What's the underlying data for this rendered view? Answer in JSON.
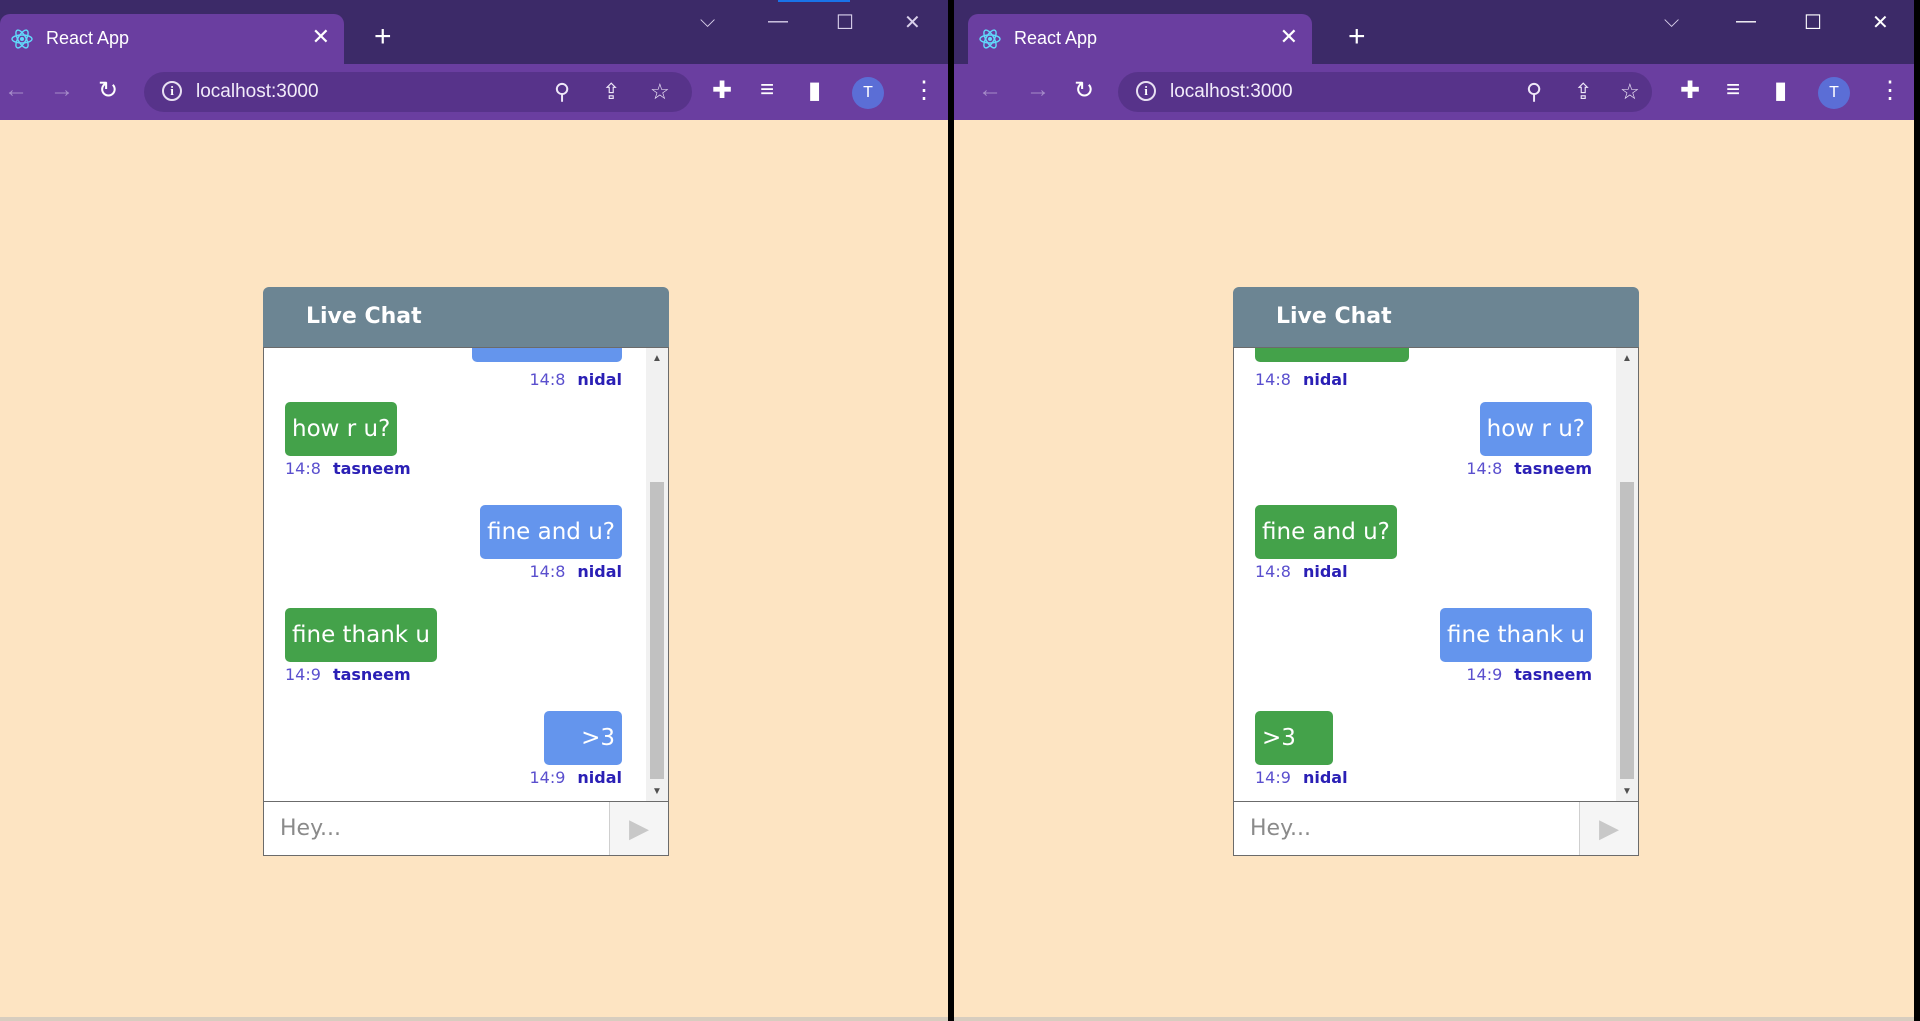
{
  "browser": {
    "tab_title": "React App",
    "tab_close": "✕",
    "new_tab": "+",
    "url": "localhost:3000",
    "avatar_initial": "T",
    "icons": [
      "react-favicon",
      "back-arrow",
      "forward-arrow",
      "reload",
      "info",
      "zoom",
      "share",
      "star",
      "extensions",
      "media-control",
      "side-panel",
      "menu"
    ]
  },
  "window_controls": {
    "dropdown": "⌵",
    "minimize": "—",
    "maximize": "☐",
    "close": "✕"
  },
  "chat": {
    "title": "Live Chat",
    "placeholder": "Hey...",
    "send_icon": "▶"
  },
  "left_messages": [
    {
      "text": "",
      "time": "14:8",
      "author": "nidal",
      "side": "right",
      "color": "blue"
    },
    {
      "text": "how r u?",
      "time": "14:8",
      "author": "tasneem",
      "side": "left",
      "color": "green"
    },
    {
      "text": "fine and u?",
      "time": "14:8",
      "author": "nidal",
      "side": "right",
      "color": "blue"
    },
    {
      "text": "fine thank u",
      "time": "14:9",
      "author": "tasneem",
      "side": "left",
      "color": "green"
    },
    {
      "text": ">3",
      "time": "14:9",
      "author": "nidal",
      "side": "right",
      "color": "blue"
    }
  ],
  "right_messages": [
    {
      "text": "",
      "time": "14:8",
      "author": "nidal",
      "side": "left",
      "color": "green"
    },
    {
      "text": "how r u?",
      "time": "14:8",
      "author": "tasneem",
      "side": "right",
      "color": "blue"
    },
    {
      "text": "fine and u?",
      "time": "14:8",
      "author": "nidal",
      "side": "left",
      "color": "green"
    },
    {
      "text": "fine thank u",
      "time": "14:9",
      "author": "tasneem",
      "side": "right",
      "color": "blue"
    },
    {
      "text": ">3",
      "time": "14:9",
      "author": "nidal",
      "side": "left",
      "color": "green"
    }
  ],
  "colors": {
    "page_bg": "#fde4c2",
    "chrome_dark": "#3c2a68",
    "chrome": "#6a3ea0",
    "chat_header": "#6c8593",
    "bubble_green": "#44a24a",
    "bubble_blue": "#6495ed",
    "time_text": "#5a4fce",
    "author_text": "#2a1fb5"
  }
}
